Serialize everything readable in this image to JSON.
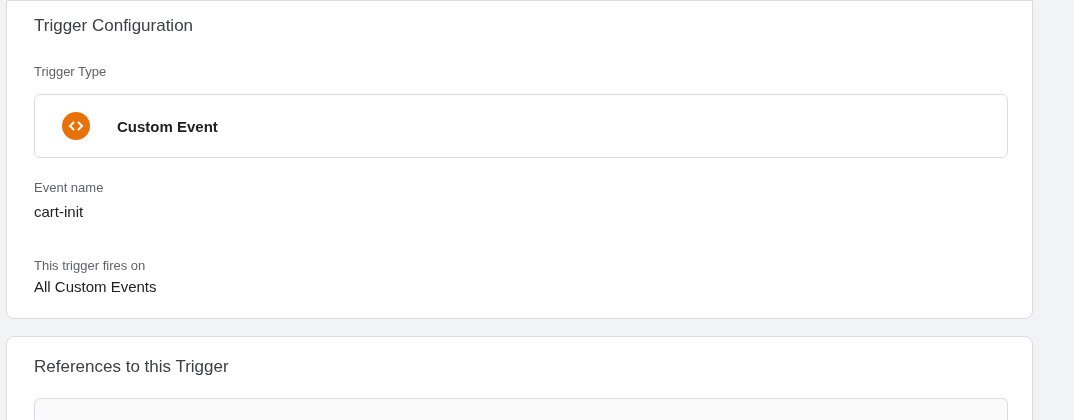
{
  "trigger_configuration": {
    "title": "Trigger Configuration",
    "trigger_type": {
      "label": "Trigger Type",
      "kind": "custom_event",
      "name": "Custom Event"
    },
    "fields": [
      {
        "label": "Event name",
        "value": "cart-init"
      },
      {
        "label": "This trigger fires on",
        "value": "All Custom Events"
      }
    ]
  },
  "references": {
    "title": "References to this Trigger"
  }
}
